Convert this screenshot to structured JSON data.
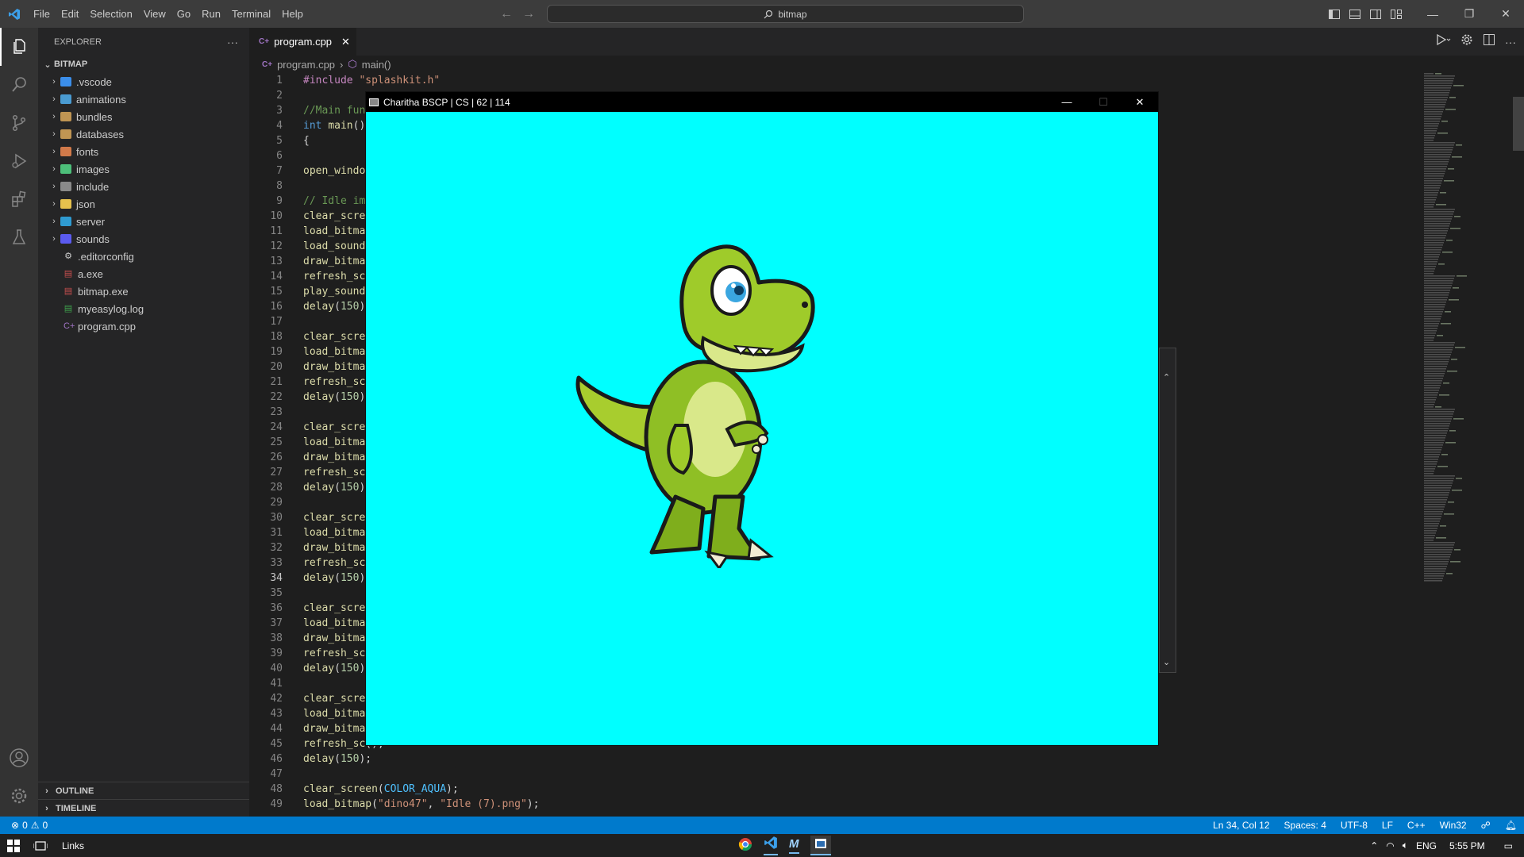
{
  "titlebar": {
    "menu": [
      "File",
      "Edit",
      "Selection",
      "View",
      "Go",
      "Run",
      "Terminal",
      "Help"
    ],
    "search_text": "bitmap"
  },
  "sidebar": {
    "header": "EXPLORER",
    "root": "BITMAP",
    "folders": [
      {
        "label": ".vscode",
        "color": "#3b8eea"
      },
      {
        "label": "animations",
        "color": "#4a9bd1"
      },
      {
        "label": "bundles",
        "color": "#c09553"
      },
      {
        "label": "databases",
        "color": "#c09553"
      },
      {
        "label": "fonts",
        "color": "#d17a4a"
      },
      {
        "label": "images",
        "color": "#4dbf7a"
      },
      {
        "label": "include",
        "color": "#8a8a8a"
      },
      {
        "label": "json",
        "color": "#e5c14d"
      },
      {
        "label": "server",
        "color": "#2f9bd1"
      },
      {
        "label": "sounds",
        "color": "#5b5bf0"
      }
    ],
    "files": [
      {
        "label": ".editorconfig",
        "color": "#cccccc",
        "glyph": "⚙"
      },
      {
        "label": "a.exe",
        "color": "#c94f4f",
        "glyph": "▤"
      },
      {
        "label": "bitmap.exe",
        "color": "#c94f4f",
        "glyph": "▤"
      },
      {
        "label": "myeasylog.log",
        "color": "#3fa34d",
        "glyph": "▤"
      },
      {
        "label": "program.cpp",
        "color": "#a074c4",
        "glyph": "C+"
      }
    ],
    "outline": "OUTLINE",
    "timeline": "TIMELINE"
  },
  "editor": {
    "tab_label": "program.cpp",
    "breadcrumb": [
      "program.cpp",
      "main()"
    ]
  },
  "code_lines": [
    {
      "n": "1",
      "html": "<span class='c-pre'>#include</span> <span class='c-str'>\"splashkit.h\"</span>"
    },
    {
      "n": "2",
      "html": ""
    },
    {
      "n": "3",
      "html": "<span class='c-cmt'>//Main fun</span>"
    },
    {
      "n": "4",
      "html": "<span class='c-kw'>int</span> <span class='c-fn'>main</span>()"
    },
    {
      "n": "5",
      "html": "{"
    },
    {
      "n": "6",
      "html": ""
    },
    {
      "n": "7",
      "html": "<span class='c-fn'>open_windo</span>"
    },
    {
      "n": "8",
      "html": ""
    },
    {
      "n": "9",
      "html": "<span class='c-cmt'>// Idle im</span>"
    },
    {
      "n": "10",
      "html": "<span class='c-fn'>clear_scre</span>"
    },
    {
      "n": "11",
      "html": "<span class='c-fn'>load_bitma</span>"
    },
    {
      "n": "12",
      "html": "<span class='c-fn'>load_sound</span>"
    },
    {
      "n": "13",
      "html": "<span class='c-fn'>draw_bitma</span>"
    },
    {
      "n": "14",
      "html": "<span class='c-fn'>refresh_sc</span>"
    },
    {
      "n": "15",
      "html": "<span class='c-fn'>play_sound</span>"
    },
    {
      "n": "16",
      "html": "<span class='c-fn'>delay</span>(<span class='c-num'>150</span>)"
    },
    {
      "n": "17",
      "html": ""
    },
    {
      "n": "18",
      "html": "<span class='c-fn'>clear_scre</span>"
    },
    {
      "n": "19",
      "html": "<span class='c-fn'>load_bitma</span>"
    },
    {
      "n": "20",
      "html": "<span class='c-fn'>draw_bitma</span>"
    },
    {
      "n": "21",
      "html": "<span class='c-fn'>refresh_sc</span>"
    },
    {
      "n": "22",
      "html": "<span class='c-fn'>delay</span>(<span class='c-num'>150</span>)"
    },
    {
      "n": "23",
      "html": ""
    },
    {
      "n": "24",
      "html": "<span class='c-fn'>clear_scre</span>"
    },
    {
      "n": "25",
      "html": "<span class='c-fn'>load_bitma</span>"
    },
    {
      "n": "26",
      "html": "<span class='c-fn'>draw_bitma</span>"
    },
    {
      "n": "27",
      "html": "<span class='c-fn'>refresh_sc</span>"
    },
    {
      "n": "28",
      "html": "<span class='c-fn'>delay</span>(<span class='c-num'>150</span>)"
    },
    {
      "n": "29",
      "html": ""
    },
    {
      "n": "30",
      "html": "<span class='c-fn'>clear_scre</span>"
    },
    {
      "n": "31",
      "html": "<span class='c-fn'>load_bitma</span>"
    },
    {
      "n": "32",
      "html": "<span class='c-fn'>draw_bitma</span>"
    },
    {
      "n": "33",
      "html": "<span class='c-fn'>refresh_sc</span>"
    },
    {
      "n": "34",
      "html": "<span class='c-fn'>delay</span>(<span class='c-num'>150</span>)"
    },
    {
      "n": "35",
      "html": ""
    },
    {
      "n": "36",
      "html": "<span class='c-fn'>clear_scre</span>"
    },
    {
      "n": "37",
      "html": "<span class='c-fn'>load_bitma</span>"
    },
    {
      "n": "38",
      "html": "<span class='c-fn'>draw_bitma</span>"
    },
    {
      "n": "39",
      "html": "<span class='c-fn'>refresh_sc</span>"
    },
    {
      "n": "40",
      "html": "<span class='c-fn'>delay</span>(<span class='c-num'>150</span>)"
    },
    {
      "n": "41",
      "html": ""
    },
    {
      "n": "42",
      "html": "<span class='c-fn'>clear_scre</span>"
    },
    {
      "n": "43",
      "html": "<span class='c-fn'>load_bitma</span>"
    },
    {
      "n": "44",
      "html": "<span class='c-fn'>draw_bitma</span>"
    },
    {
      "n": "45",
      "html": "<span class='c-fn'>refresh_sc</span>()<span>;</span>"
    },
    {
      "n": "46",
      "html": "<span class='c-fn'>delay</span>(<span class='c-num'>150</span>);"
    },
    {
      "n": "47",
      "html": ""
    },
    {
      "n": "48",
      "html": "<span class='c-fn'>clear_screen</span>(<span class='c-const'>COLOR_AQUA</span>);"
    },
    {
      "n": "49",
      "html": "<span class='c-fn'>load_bitmap</span>(<span class='c-str'>\"dino47\"</span>, <span class='c-str'>\"Idle (7).png\"</span>);"
    }
  ],
  "current_line": "34",
  "splashkit_window": {
    "title": "Charitha BSCP | CS | 62 | 114",
    "background": "#00ffff"
  },
  "statusbar": {
    "errors": "0",
    "warnings": "0",
    "position": "Ln 34, Col 12",
    "spaces": "Spaces: 4",
    "encoding": "UTF-8",
    "eol": "LF",
    "language": "C++",
    "platform": "Win32"
  },
  "taskbar": {
    "links": "Links",
    "lang": "ENG",
    "time": "5:55 PM"
  },
  "colors": {
    "accent": "#007acc",
    "editor_bg": "#1e1e1e",
    "sidebar_bg": "#252526"
  }
}
